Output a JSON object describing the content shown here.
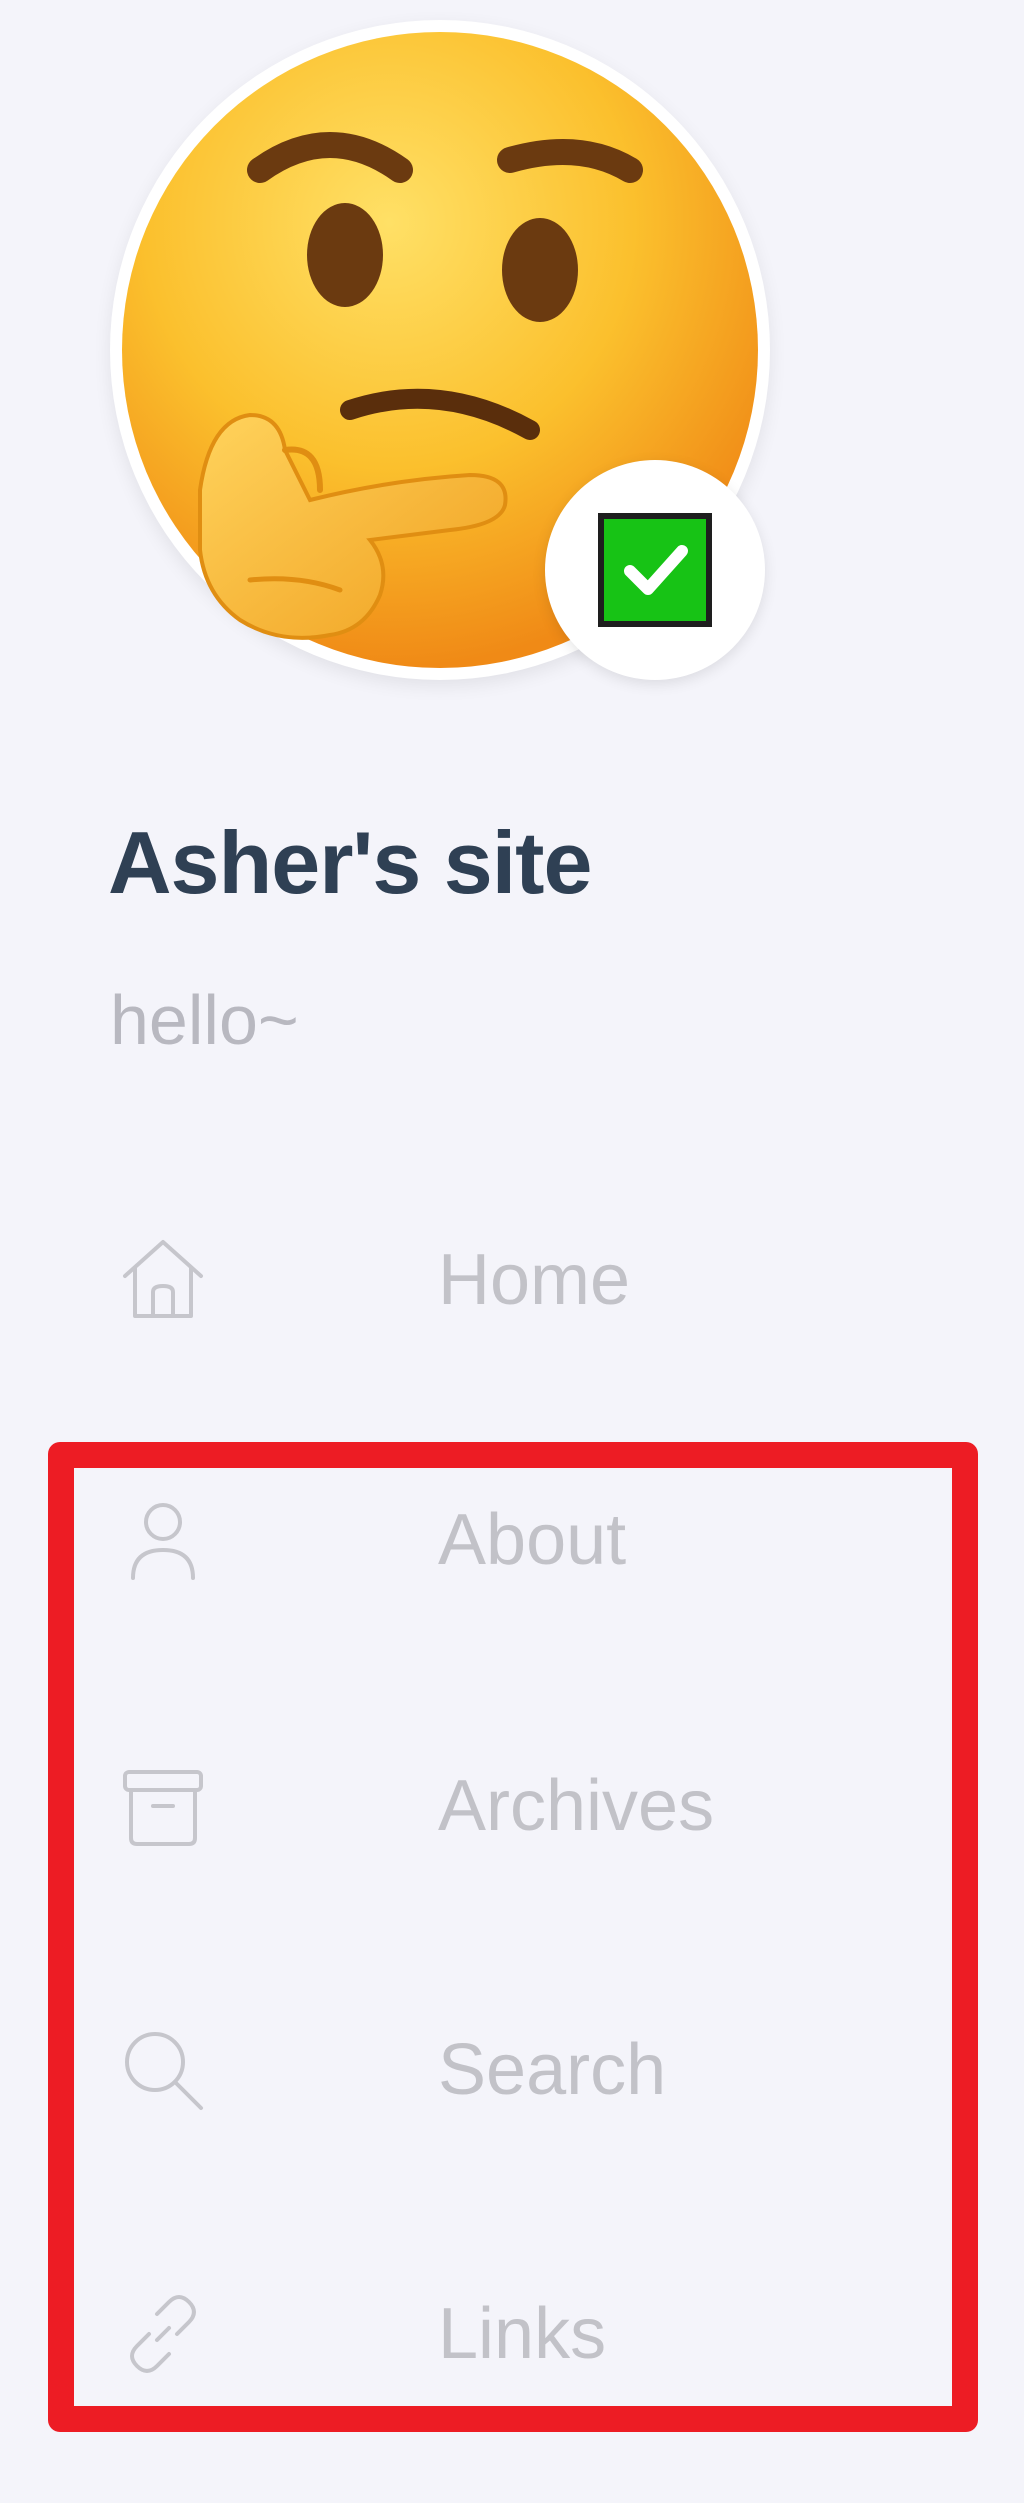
{
  "site": {
    "title": "Asher's site",
    "subtitle": "hello~"
  },
  "avatar": {
    "icon": "thinking-face-emoji",
    "status_icon": "check-mark-button"
  },
  "nav": {
    "items": [
      {
        "label": "Home",
        "icon": "home-icon"
      },
      {
        "label": "About",
        "icon": "user-icon"
      },
      {
        "label": "Archives",
        "icon": "archive-icon"
      },
      {
        "label": "Search",
        "icon": "search-icon"
      },
      {
        "label": "Links",
        "icon": "link-icon"
      }
    ]
  },
  "colors": {
    "background": "#f4f4fa",
    "title": "#2f4054",
    "muted_text": "#b8b8c0",
    "highlight": "#ed1c24",
    "status_green": "#17c315"
  }
}
